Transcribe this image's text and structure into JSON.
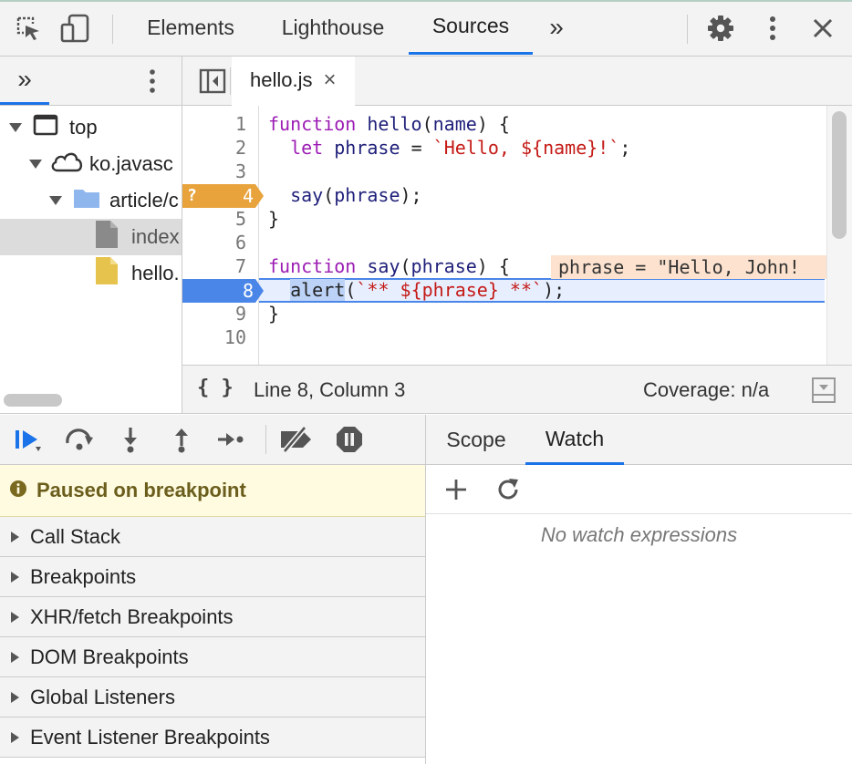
{
  "toolbar": {
    "tabs": [
      {
        "label": "Elements"
      },
      {
        "label": "Lighthouse"
      },
      {
        "label": "Sources",
        "active": true
      }
    ],
    "more_tabs_glyph": "»",
    "icons": [
      "inspect-element-icon",
      "device-toolbar-icon",
      "more-tabs-icon",
      "settings-gear-icon",
      "kebab-menu-icon",
      "close-icon"
    ]
  },
  "navigator": {
    "more_glyph": "»",
    "tree": [
      {
        "label": "top",
        "icon": "frame-icon"
      },
      {
        "label": "ko.javasc",
        "icon": "cloud-icon"
      },
      {
        "label": "article/c",
        "icon": "folder-icon"
      },
      {
        "label": "index",
        "icon": "file-icon-gray",
        "selected": true
      },
      {
        "label": "hello.",
        "icon": "file-icon-yellow"
      }
    ]
  },
  "editor": {
    "file_tab": {
      "label": "hello.js",
      "close_glyph": "×"
    },
    "line_numbers": [
      "1",
      "2",
      "3",
      "4",
      "5",
      "6",
      "7",
      "8",
      "9",
      "10"
    ],
    "lines": [
      "function hello(name) {",
      "  let phrase = `Hello, ${name}!`;",
      "",
      "  say(phrase);",
      "}",
      "",
      "function say(phrase) {",
      "  alert(`** ${phrase} **`);",
      "}",
      ""
    ],
    "conditional_breakpoint_marker": "?",
    "inline_value": "phrase = \"Hello, John!",
    "accent_current_line": "#4a85e8",
    "accent_conditional_breakpoint": "#e8a33d"
  },
  "status_bar": {
    "pretty_print_glyph": "{ }",
    "position": "Line 8, Column 3",
    "coverage": "Coverage: n/a"
  },
  "debugger": {
    "buttons": [
      "resume-icon",
      "step-over-icon",
      "step-into-icon",
      "step-out-icon",
      "step-icon",
      "deactivate-breakpoints-icon",
      "pause-on-exceptions-icon"
    ],
    "paused_message": "Paused on breakpoint",
    "sections": [
      "Call Stack",
      "Breakpoints",
      "XHR/fetch Breakpoints",
      "DOM Breakpoints",
      "Global Listeners",
      "Event Listener Breakpoints"
    ]
  },
  "right_pane": {
    "tabs": [
      {
        "label": "Scope"
      },
      {
        "label": "Watch",
        "active": true
      }
    ],
    "watch_empty": "No watch expressions"
  }
}
